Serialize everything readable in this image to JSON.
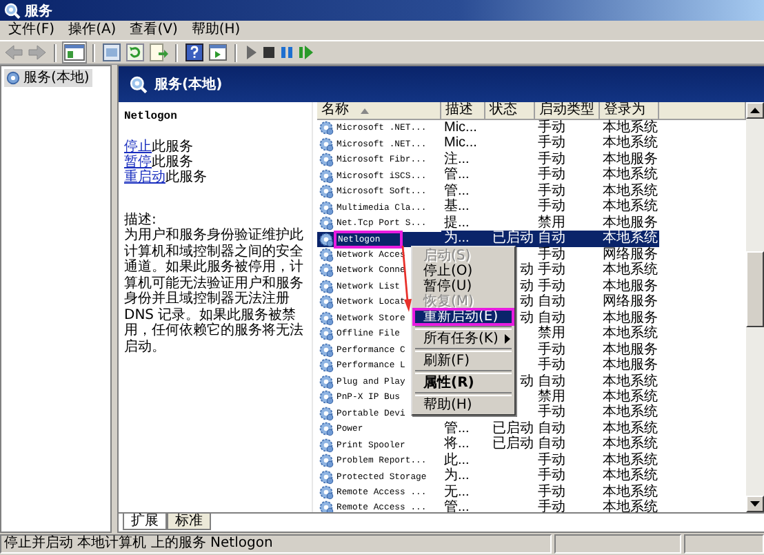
{
  "window": {
    "title": "服务"
  },
  "menu": [
    "文件(F)",
    "操作(A)",
    "查看(V)",
    "帮助(H)"
  ],
  "tree": [
    {
      "label": "服务(本地)",
      "selected": true
    }
  ],
  "panel": {
    "title": "服务(本地)"
  },
  "detail": {
    "service": "Netlogon",
    "actions": [
      {
        "link": "停止",
        "text": "此服务"
      },
      {
        "link": "暂停",
        "text": "此服务"
      },
      {
        "link": "重启动",
        "text": "此服务"
      }
    ],
    "description_label": "描述:",
    "description": "为用户和服务身份验证维护此计算机和域控制器之间的安全通道。如果此服务被停用，计算机可能无法验证用户和服务身份并且域控制器无法注册 DNS 记录。如果此服务被禁用，任何依赖它的服务将无法启动。"
  },
  "table": {
    "columns": [
      {
        "label": "名称",
        "sorted": true
      },
      {
        "label": "描述",
        "sorted": false
      },
      {
        "label": "状态",
        "sorted": false
      },
      {
        "label": "启动类型",
        "sorted": false
      },
      {
        "label": "登录为",
        "sorted": false
      }
    ],
    "rows": [
      {
        "name": "Microsoft .NET...",
        "description": "Mic...",
        "startup": "手动",
        "logon": "本地系统",
        "selected": false,
        "marked": false
      },
      {
        "name": "Microsoft .NET...",
        "description": "Mic...",
        "startup": "手动",
        "logon": "本地系统",
        "selected": false,
        "marked": false
      },
      {
        "name": "Microsoft Fibr...",
        "description": "注...",
        "startup": "手动",
        "logon": "本地服务",
        "selected": false,
        "marked": false
      },
      {
        "name": "Microsoft iSCS...",
        "description": "管...",
        "startup": "手动",
        "logon": "本地系统",
        "selected": false,
        "marked": false
      },
      {
        "name": "Microsoft Soft...",
        "description": "管...",
        "startup": "手动",
        "logon": "本地系统",
        "selected": false,
        "marked": false
      },
      {
        "name": "Multimedia Cla...",
        "description": "基...",
        "startup": "手动",
        "logon": "本地系统",
        "selected": false,
        "marked": false
      },
      {
        "name": "Net.Tcp Port S...",
        "description": "提...",
        "startup": "禁用",
        "logon": "本地服务",
        "selected": false,
        "marked": false
      },
      {
        "name": "Netlogon",
        "description": "为...",
        "status": "已启动",
        "startup": "自动",
        "logon": "本地系统",
        "selected": true,
        "marked": true
      },
      {
        "name": "Network Acces",
        "startup": "手动",
        "logon": "网络服务",
        "selected": false,
        "marked": false
      },
      {
        "name": "Network Conne",
        "status": "动",
        "startup": "手动",
        "logon": "本地系统",
        "selected": false,
        "marked": false
      },
      {
        "name": "Network List",
        "status": "动",
        "startup": "手动",
        "logon": "本地服务",
        "selected": false,
        "marked": false
      },
      {
        "name": "Network Locat",
        "status": "动",
        "startup": "自动",
        "logon": "网络服务",
        "selected": false,
        "marked": false
      },
      {
        "name": "Network Store",
        "status": "动",
        "startup": "自动",
        "logon": "本地服务",
        "selected": false,
        "marked": false
      },
      {
        "name": "Offline File",
        "startup": "禁用",
        "logon": "本地系统",
        "selected": false,
        "marked": false
      },
      {
        "name": "Performance C",
        "startup": "手动",
        "logon": "本地服务",
        "selected": false,
        "marked": false
      },
      {
        "name": "Performance L",
        "startup": "手动",
        "logon": "本地服务",
        "selected": false,
        "marked": false
      },
      {
        "name": "Plug and Play",
        "status": "动",
        "startup": "自动",
        "logon": "本地系统",
        "selected": false,
        "marked": false
      },
      {
        "name": "PnP-X IP Bus",
        "startup": "禁用",
        "logon": "本地系统",
        "selected": false,
        "marked": false
      },
      {
        "name": "Portable Devi",
        "startup": "手动",
        "logon": "本地系统",
        "selected": false,
        "marked": false
      },
      {
        "name": "Power",
        "description": "管...",
        "status": "已启动",
        "startup": "自动",
        "logon": "本地系统",
        "selected": false,
        "marked": false
      },
      {
        "name": "Print Spooler",
        "description": "将...",
        "status": "已启动",
        "startup": "自动",
        "logon": "本地系统",
        "selected": false,
        "marked": false
      },
      {
        "name": "Problem Report...",
        "description": "此...",
        "startup": "手动",
        "logon": "本地系统",
        "selected": false,
        "marked": false
      },
      {
        "name": "Protected Storage",
        "description": "为...",
        "startup": "手动",
        "logon": "本地系统",
        "selected": false,
        "marked": false
      },
      {
        "name": "Remote Access ...",
        "description": "无...",
        "startup": "手动",
        "logon": "本地系统",
        "selected": false,
        "marked": false
      },
      {
        "name": "Remote Access ...",
        "description": "管...",
        "startup": "手动",
        "logon": "本地系统",
        "selected": false,
        "marked": false
      }
    ]
  },
  "context_menu": {
    "items": [
      {
        "kind": "item",
        "label": "启动(S)",
        "disabled": true,
        "selected": false,
        "marked": false,
        "default": false,
        "submenu": false
      },
      {
        "kind": "item",
        "label": "停止(O)",
        "disabled": false,
        "selected": false,
        "marked": false,
        "default": false,
        "submenu": false
      },
      {
        "kind": "item",
        "label": "暂停(U)",
        "disabled": false,
        "selected": false,
        "marked": false,
        "default": false,
        "submenu": false
      },
      {
        "kind": "item",
        "label": "恢复(M)",
        "disabled": true,
        "selected": false,
        "marked": false,
        "default": false,
        "submenu": false
      },
      {
        "kind": "item",
        "label": "重新启动(E)",
        "disabled": false,
        "selected": true,
        "marked": true,
        "default": false,
        "submenu": false
      },
      {
        "kind": "separator"
      },
      {
        "kind": "item",
        "label": "所有任务(K)",
        "disabled": false,
        "selected": false,
        "marked": false,
        "default": false,
        "submenu": true
      },
      {
        "kind": "separator"
      },
      {
        "kind": "item",
        "label": "刷新(F)",
        "disabled": false,
        "selected": false,
        "marked": false,
        "default": false,
        "submenu": false
      },
      {
        "kind": "separator"
      },
      {
        "kind": "item",
        "label": "属性(R)",
        "disabled": false,
        "selected": false,
        "marked": false,
        "default": true,
        "submenu": false
      },
      {
        "kind": "separator"
      },
      {
        "kind": "item",
        "label": "帮助(H)",
        "disabled": false,
        "selected": false,
        "marked": false,
        "default": false,
        "submenu": false
      }
    ]
  },
  "tabs": [
    {
      "label": "扩展",
      "selected": true
    },
    {
      "label": "标准",
      "selected": false
    }
  ],
  "status_bar": [
    "停止并启动 本地计算机 上的服务 Netlogon"
  ]
}
